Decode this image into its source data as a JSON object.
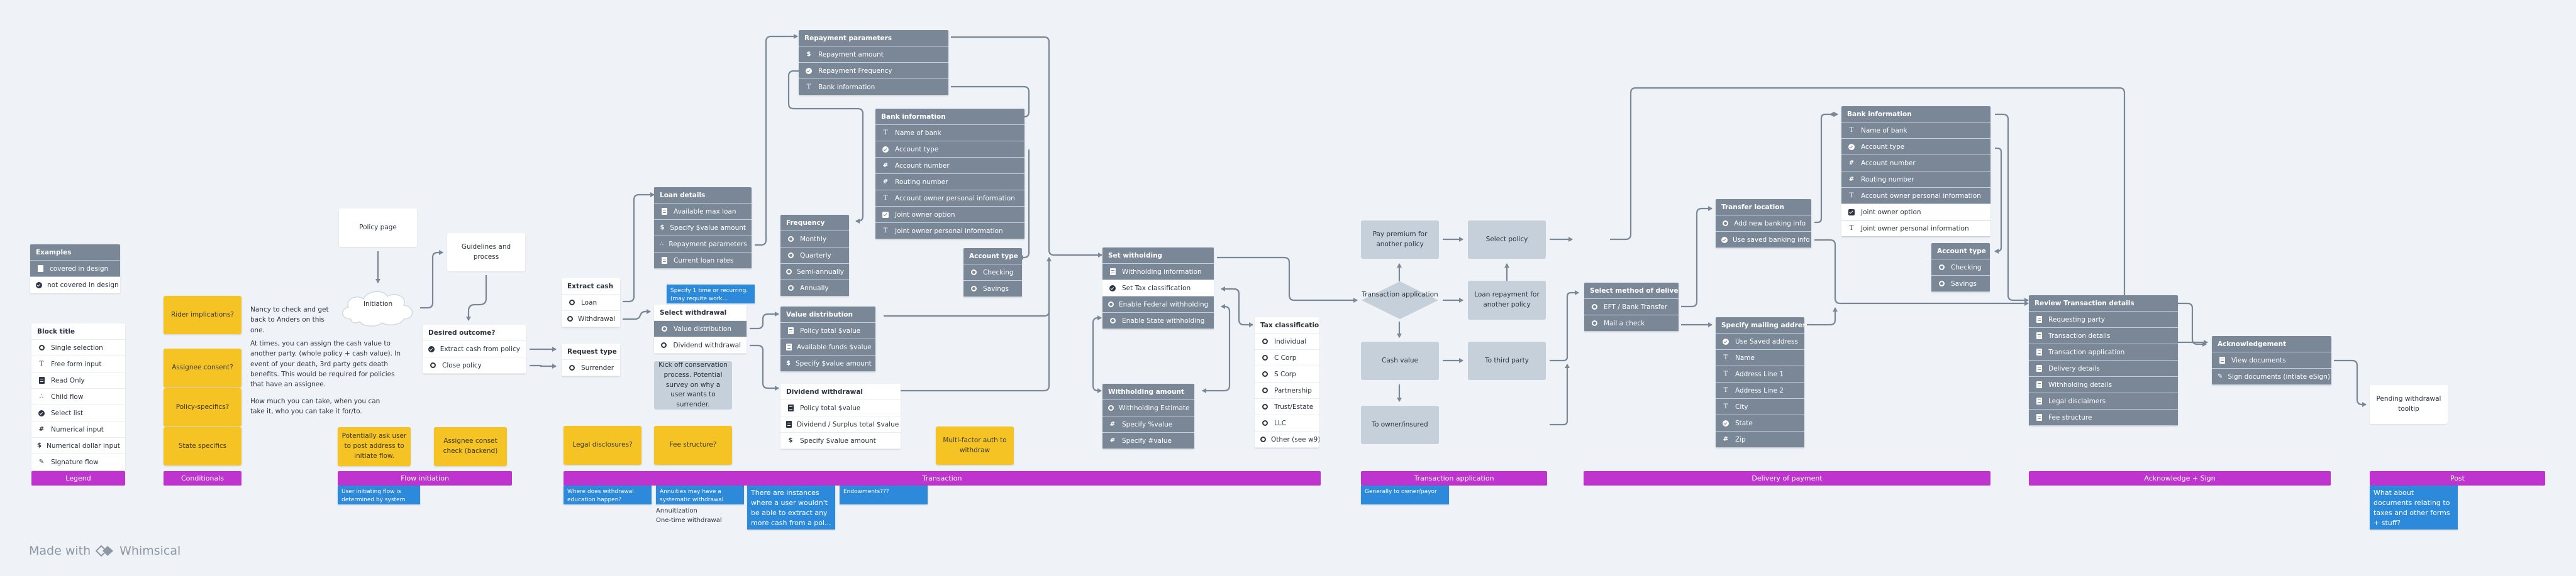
{
  "legend": {
    "examples": {
      "title": "Examples",
      "items": [
        {
          "icon": "read-only-icon",
          "label": "covered in design"
        },
        {
          "icon": "select-list-icon",
          "label": "not covered in design"
        }
      ]
    },
    "block": {
      "title": "Block title",
      "items": [
        {
          "icon": "single-selection-icon",
          "label": "Single selection"
        },
        {
          "icon": "free-form-input-icon",
          "label": "Free form input"
        },
        {
          "icon": "read-only-icon",
          "label": "Read Only"
        },
        {
          "icon": "child-flow-icon",
          "label": "Child flow"
        },
        {
          "icon": "select-list-icon",
          "label": "Select list"
        },
        {
          "icon": "numerical-input-icon",
          "label": "Numerical input"
        },
        {
          "icon": "dollar-input-icon",
          "label": "Numerical dollar input"
        },
        {
          "icon": "signature-icon",
          "label": "Signature flow"
        }
      ]
    }
  },
  "conditionals": {
    "stickies": [
      "Rider implications?",
      "Assignee consent?",
      "Policy-specifics?",
      "State specifics"
    ],
    "notes": [
      "Nancy to check and get back to Anders on this one.",
      "At times, you can assign the cash value to another party. (whole policy + cash value). In event of your death, 3rd party gets death benefits. This would be required for policies that have an assignee.",
      "How much you can take, when you can take it, who you can take it for/to."
    ]
  },
  "flow_initiation": {
    "policy_page": "Policy page",
    "initiation": "Initiation",
    "guidelines": "Guidelines and process",
    "desired_outcome": {
      "title": "Desired outcome?",
      "items": [
        "Extract cash from policy",
        "Close policy"
      ]
    },
    "stickies": [
      "Potentially ask user to post address to initiate flow.",
      "Assignee conset check (backend)"
    ],
    "notes": [
      "User initiating flow is determined by system"
    ]
  },
  "transaction": {
    "extract_cash": {
      "title": "Extract cash",
      "items": [
        "Loan",
        "Withdrawal"
      ]
    },
    "request_type": {
      "title": "Request type",
      "items": [
        "Surrender"
      ]
    },
    "loan_details": {
      "title": "Loan details",
      "items": [
        "Available max loan",
        "Specify $value amount",
        "Repayment parameters",
        "Current loan rates"
      ]
    },
    "repayment": {
      "title": "Repayment parameters",
      "items": [
        "Repayment amount",
        "Repayment Frequency",
        "Bank information"
      ]
    },
    "bank_info": {
      "title": "Bank information",
      "items": [
        "Name of bank",
        "Account type",
        "Account number",
        "Routing number",
        "Account owner personal information",
        "Joint owner option",
        "Joint owner personal information"
      ]
    },
    "frequency": {
      "title": "Frequency",
      "items": [
        "Monthly",
        "Quarterly",
        "Semi-annually",
        "Annually"
      ]
    },
    "account_type": {
      "title": "Account type",
      "items": [
        "Checking",
        "Savings"
      ]
    },
    "select_withdrawal": {
      "title": "Select withdrawal",
      "items": [
        "Value distribution",
        "Dividend withdrawal"
      ]
    },
    "specify_note": "Specify 1 time or recurring. (may requite work...",
    "conservation": "Kick off conservation process. Potential survey on why a user wants to surrender.",
    "value_distribution": {
      "title": "Value distribution",
      "items": [
        "Policy total $value",
        "Available funds $value",
        "Specify $value amount"
      ]
    },
    "dividend_withdrawal": {
      "title": "Dividend withdrawal",
      "items": [
        "Policy total $value",
        "Dividend / Surplus total $value",
        "Specify $value amount"
      ]
    },
    "set_withholding": {
      "title": "Set witholding",
      "items": [
        "Withholding information",
        "Set Tax classification",
        "Enable Federal withholding",
        "Enable State withholding"
      ]
    },
    "withholding_amount": {
      "title": "Withholding amount",
      "items": [
        "Withholding Estimate",
        "Specify %value",
        "Specify #value"
      ]
    },
    "tax_classification": {
      "title": "Tax classification",
      "items": [
        "Individual",
        "C Corp",
        "S Corp",
        "Partnership",
        "Trust/Estate",
        "LLC",
        "Other (see w9)"
      ]
    },
    "stickies": [
      "Legal disclosures?",
      "Fee structure?",
      "Multi-factor auth to withdraw"
    ],
    "notes": [
      "Where does withdrawal education happen?",
      "Annuities may have a systematic withdrawal (SWP)",
      "There are instances where a user wouldn't be able to extract any more cash from a pol...",
      "Endowments???"
    ],
    "extra_text": [
      "Annuitization",
      "One-time withdrawal"
    ]
  },
  "transaction_application": {
    "decision": "Transaction application",
    "nodes": [
      "Pay premium for another policy",
      "Select policy",
      "Loan repayment for another policy",
      "Cash value",
      "To third party",
      "To owner/insured"
    ],
    "notes": [
      "Generally to owner/payor"
    ]
  },
  "delivery": {
    "method": {
      "title": "Select method of delivery",
      "items": [
        "EFT / Bank Transfer",
        "Mail a check"
      ]
    },
    "transfer_location": {
      "title": "Transfer location",
      "items": [
        "Add new banking info",
        "Use saved banking info"
      ]
    },
    "mailing": {
      "title": "Specify mailing address",
      "items": [
        "Use Saved address",
        "Name",
        "Address Line 1",
        "Address Line 2",
        "City",
        "State",
        "Zip"
      ]
    },
    "bank_info": {
      "title": "Bank information",
      "items": [
        "Name of bank",
        "Account type",
        "Account number",
        "Routing number",
        "Account owner personal information",
        "Joint owner option",
        "Joint owner personal information"
      ]
    },
    "account_type": {
      "title": "Account type",
      "items": [
        "Checking",
        "Savings"
      ]
    }
  },
  "ack_sign": {
    "review": {
      "title": "Review Transaction details",
      "items": [
        "Requesting party",
        "Transaction details",
        "Transaction application",
        "Delivery details",
        "Withholding details",
        "Legal disclaimers",
        "Fee structure"
      ]
    },
    "acknowledgement": {
      "title": "Acknowledgement",
      "items": [
        "View documents",
        "Sign documents (intiate eSign)"
      ]
    }
  },
  "post": {
    "pending": "Pending withdrawal tooltip",
    "notes": [
      "What about documents relating to taxes and other forms + stuff?"
    ]
  },
  "sections": [
    "Legend",
    "Conditionals",
    "Flow initiation",
    "Transaction",
    "Transaction application",
    "Delivery of payment",
    "Acknowledge + Sign",
    "Post"
  ],
  "branding": {
    "prefix": "Made with",
    "name": "Whimsical"
  },
  "colors": {
    "section": "#bf33cf",
    "sticky": "#f6c325",
    "note": "#2d89d9",
    "block_gray": "#7a8796",
    "background": "#eff3f7"
  }
}
